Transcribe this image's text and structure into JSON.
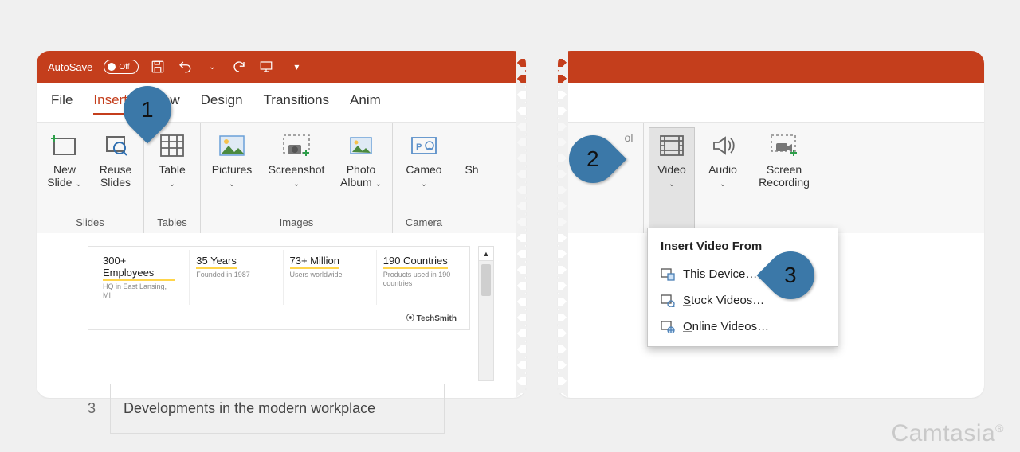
{
  "titlebar": {
    "autosave_label": "AutoSave",
    "autosave_state": "Off"
  },
  "tabs": {
    "file": "File",
    "insert": "Insert",
    "draw": "Draw",
    "design": "Design",
    "transitions": "Transitions",
    "animations": "Anim"
  },
  "ribbon": {
    "slides": {
      "group": "Slides",
      "new_slide": "New Slide",
      "reuse_slides": "Reuse Slides"
    },
    "tables": {
      "group": "Tables",
      "table": "Table"
    },
    "images": {
      "group": "Images",
      "pictures": "Pictures",
      "screenshot": "Screenshot",
      "photo_album": "Photo Album"
    },
    "camera": {
      "group": "Camera",
      "cameo": "Cameo"
    },
    "shapes_cut": "Sh",
    "media": {
      "video": "Video",
      "audio": "Audio",
      "screen_recording": "Screen Recording"
    }
  },
  "dropdown": {
    "header": "Insert Video From",
    "this_device": "This Device…",
    "stock_videos": "Stock Videos…",
    "online_videos": "Online Videos…"
  },
  "stats": [
    {
      "big": "300+ Employees",
      "sub": "HQ in East Lansing, MI"
    },
    {
      "big": "35 Years",
      "sub": "Founded in 1987"
    },
    {
      "big": "73+ Million",
      "sub": "Users worldwide"
    },
    {
      "big": "190 Countries",
      "sub": "Products used in 190 countries"
    }
  ],
  "techsmith": "⦿ TechSmith",
  "slide3": {
    "num": "3",
    "title": "Developments in the modern workplace"
  },
  "callouts": {
    "c1": "1",
    "c2": "2",
    "c3": "3"
  },
  "watermark": "Camtasia"
}
